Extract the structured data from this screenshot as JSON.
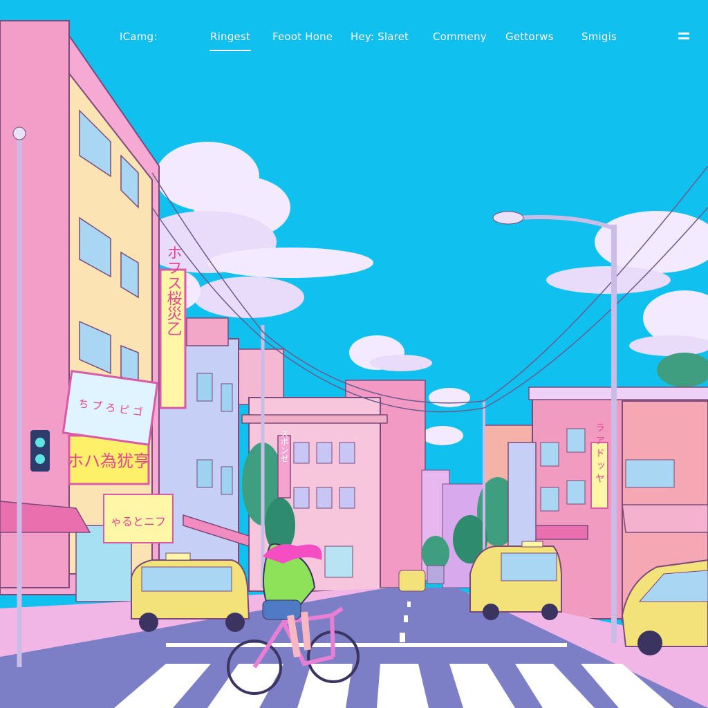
{
  "nav": {
    "brand": "ICamg:",
    "tabs": [
      {
        "label": "Rinɡest",
        "active": true
      },
      {
        "label": "Feoot Hone",
        "active": false
      },
      {
        "label": "Hey: Slaret",
        "active": false
      },
      {
        "label": "Commeny",
        "active": false
      },
      {
        "label": "Gettorws",
        "active": false
      },
      {
        "label": "Smigis",
        "active": false
      }
    ],
    "menu_icon": "hamburger-menu-icon"
  },
  "scene": {
    "description_icon": "city-street-illustration",
    "signs": {
      "vertical_left": "ホフス桜災乙",
      "shop_main": "ホハ為犹亨",
      "shop_small": "ゃるとニフ",
      "shop_strip": "ち ブ゙ ろ ピ ゴ",
      "vertical_right": "ラ ア ド ッ ヤ",
      "vertical_mid": "スポンゼ"
    },
    "colors": {
      "sky": "#10c0ee",
      "cloud": "#f4eaff",
      "cloud_shadow": "#d6c3f3",
      "building_pink": "#f3a7d4",
      "building_cream": "#fbe3b4",
      "road": "#7d7fc6",
      "taxi": "#f3e27a"
    }
  }
}
